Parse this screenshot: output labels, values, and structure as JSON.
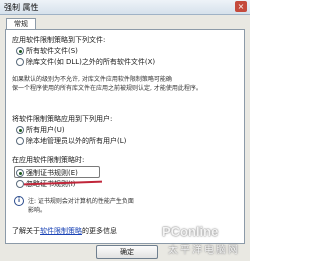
{
  "window": {
    "title": "强制 属性",
    "close_glyph": "×"
  },
  "tab": {
    "label": "常规"
  },
  "section_apply": {
    "heading": "应用软件限制策略到下列文件:",
    "options": [
      {
        "label": "所有软件文件(S)",
        "selected": true
      },
      {
        "label": "除库文件(如 DLL)之外的所有软件文件(X)",
        "selected": false
      }
    ],
    "note": [
      "如果默认的级别为不允许, 对库文件应用软件限制策略可能确",
      "保一个程序使用的所有库文件在应用之前被规则认定, 才能使用此程序。"
    ]
  },
  "section_users": {
    "heading": "将软件限制策略应用到下列用户:",
    "options": [
      {
        "label": "所有用户(U)",
        "selected": true
      },
      {
        "label": "除本地管理员以外的所有用户(L)",
        "selected": false
      }
    ]
  },
  "section_enforce": {
    "heading": "在应用软件限制策略时:",
    "options": [
      {
        "label": "强制证书规则(E)",
        "selected": true
      },
      {
        "label": "忽略证书规则(I)",
        "selected": false
      }
    ],
    "note": [
      "注: 证书规则会对计算机的性能产生负面",
      "影响。"
    ]
  },
  "footer_link": {
    "prefix": "了解关于",
    "link": "软件限制策略",
    "suffix": "的更多信息"
  },
  "buttons": {
    "ok": "确定"
  },
  "watermark": {
    "logo": "PConline",
    "sub": "太平洋电脑网"
  },
  "colors": {
    "accent": "#1d5a1d",
    "annotation_red": "#c0263a",
    "link": "#1a43b5"
  }
}
